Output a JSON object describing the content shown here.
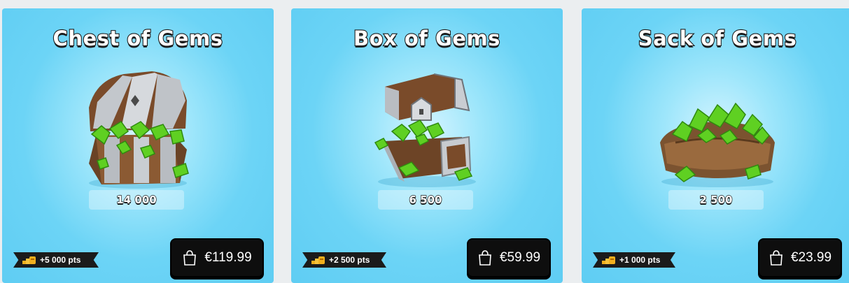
{
  "offers": [
    {
      "title": "Chest of Gems",
      "amount": "14 000",
      "points": "+5 000 pts",
      "price": "€119.99",
      "art_icon": "gem-chest-icon"
    },
    {
      "title": "Box of Gems",
      "amount": "6 500",
      "points": "+2 500 pts",
      "price": "€59.99",
      "art_icon": "gem-box-icon"
    },
    {
      "title": "Sack of Gems",
      "amount": "2 500",
      "points": "+1 000 pts",
      "price": "€23.99",
      "art_icon": "gem-sack-icon"
    }
  ],
  "colors": {
    "card_bg": "#6cd4f6",
    "gem_green": "#5fd022",
    "button_bg": "#0e0e0e",
    "points_tag_bg": "#1b1b1b"
  }
}
